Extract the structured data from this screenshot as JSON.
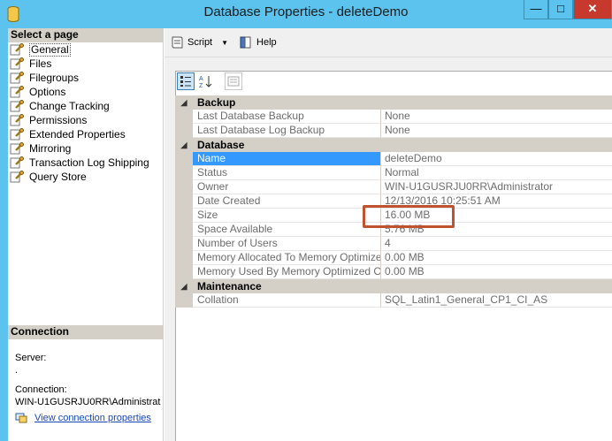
{
  "window": {
    "title": "Database Properties - deleteDemo",
    "minimize": "—",
    "maximize": "□",
    "close": "✕"
  },
  "left": {
    "select_page_title": "Select a page",
    "pages": [
      {
        "label": "General",
        "selected": true
      },
      {
        "label": "Files"
      },
      {
        "label": "Filegroups"
      },
      {
        "label": "Options"
      },
      {
        "label": "Change Tracking"
      },
      {
        "label": "Permissions"
      },
      {
        "label": "Extended Properties"
      },
      {
        "label": "Mirroring"
      },
      {
        "label": "Transaction Log Shipping"
      },
      {
        "label": "Query Store"
      }
    ],
    "connection": {
      "title": "Connection",
      "server_label": "Server:",
      "server_value": ".",
      "connection_label": "Connection:",
      "connection_value": "WIN-U1GUSRJU0RR\\Administrat",
      "view_link": "View connection properties"
    }
  },
  "toolbar": {
    "script_label": "Script",
    "help_label": "Help"
  },
  "grid": {
    "categories": [
      {
        "name": "Backup",
        "rows": [
          {
            "key": "Last Database Backup",
            "value": "None"
          },
          {
            "key": "Last Database Log Backup",
            "value": "None"
          }
        ]
      },
      {
        "name": "Database",
        "rows": [
          {
            "key": "Name",
            "value": "deleteDemo",
            "selected": true
          },
          {
            "key": "Status",
            "value": "Normal"
          },
          {
            "key": "Owner",
            "value": "WIN-U1GUSRJU0RR\\Administrator"
          },
          {
            "key": "Date Created",
            "value": "12/13/2016 10:25:51 AM"
          },
          {
            "key": "Size",
            "value": "16.00 MB"
          },
          {
            "key": "Space Available",
            "value": "5.76 MB"
          },
          {
            "key": "Number of Users",
            "value": "4"
          },
          {
            "key": "Memory Allocated To Memory Optimized Obj",
            "value": "0.00 MB"
          },
          {
            "key": "Memory Used By Memory Optimized Objects",
            "value": "0.00 MB"
          }
        ]
      },
      {
        "name": "Maintenance",
        "rows": [
          {
            "key": "Collation",
            "value": "SQL_Latin1_General_CP1_CI_AS"
          }
        ]
      }
    ]
  },
  "colors": {
    "titlebar": "#5bc3ee",
    "selection": "#3399ff",
    "highlight_box": "#c0522f",
    "link": "#1747b8"
  }
}
